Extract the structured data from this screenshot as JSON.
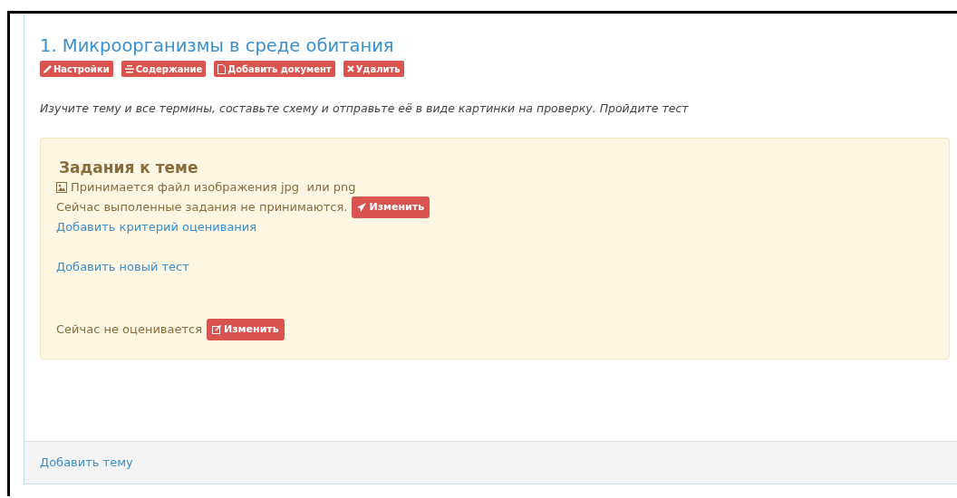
{
  "topic": {
    "title": "1. Микроорганизмы в среде обитания",
    "actions": [
      {
        "label": "Настройки"
      },
      {
        "label": "Содержание"
      },
      {
        "label": "Добавить документ"
      },
      {
        "label": "Удалить"
      }
    ],
    "description": "Изучите тему и все термины, составьте схему и отправьте её в виде картинки на проверку. Пройдите тест"
  },
  "tasks": {
    "heading": "Задания к теме",
    "file_note": "Принимается файл изображения jpg  или png",
    "submission_status": "Сейчас выполенные задания не принимаются.",
    "submission_button": "Изменить",
    "criteria_link": "Добавить критерий оценивания",
    "test_link": "Добавить новый тест",
    "grading_status": "Сейчас не оценивается",
    "grading_button": "Изменить"
  },
  "footer": {
    "add_topic_link": "Добавить тему"
  }
}
